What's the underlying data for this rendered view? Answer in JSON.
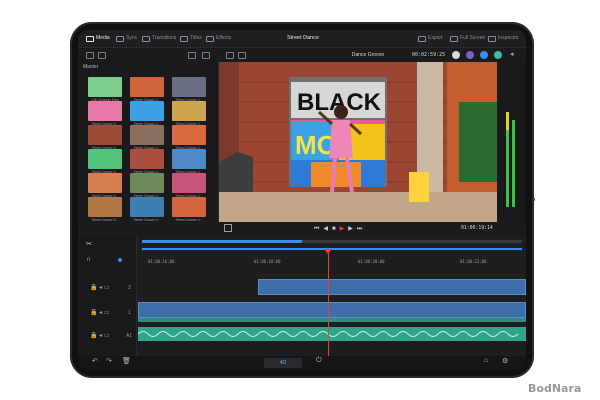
{
  "project_title": "Street Dance",
  "toolbar": {
    "left": [
      "Media",
      "Sync",
      "Transitions",
      "Titles",
      "Effects"
    ],
    "right": [
      "Export",
      "Full Screen",
      "Inspector"
    ]
  },
  "viewer": {
    "title": "Dance Groove",
    "timecode_top": "00:02:59:25",
    "timecode_bottom": "01:00:19:14"
  },
  "media_pool": {
    "label": "Master",
    "clips": [
      "Clip Graphic Red",
      "Street Dance 0...",
      "Street Dance 0...",
      "Street Dance 0...",
      "Street Dance 0...",
      "Street Dance 0...",
      "Street Dance 0...",
      "Street Dance 0...",
      "Street Dance 0...",
      "Street Dance 0...",
      "Street Dance 0...",
      "Street Dance 0...",
      "Street Dance 0...",
      "Street Dance 0...",
      "Street Dance 0...",
      "Street Dance 0...",
      "Street Dance 0...",
      "Street Dance 0..."
    ]
  },
  "timeline": {
    "ruler": [
      "01:00:16:00",
      "01:00:18:00",
      "01:00:20:00",
      "01:00:22:00"
    ],
    "track_labels": [
      "2",
      "1",
      "A1"
    ]
  },
  "page_timecode": "4Ω",
  "watermark": "BodNara",
  "colors": {
    "accent_blue": "#3a8df0",
    "playhead": "#e0452f",
    "audio_green": "#3bbf9c"
  }
}
